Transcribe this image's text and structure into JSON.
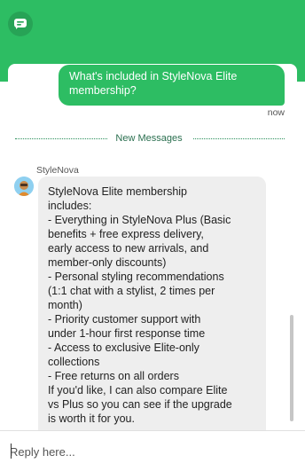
{
  "header": {
    "logo_icon": "chat-bubble-icon",
    "brand_color": "#2dbd63"
  },
  "conversation": {
    "user_message": {
      "lines": [
        "What's included in StyleNova Elite",
        "membership?"
      ],
      "timestamp": "now"
    },
    "divider_label": "New Messages",
    "bot_message": {
      "sender": "StyleNova",
      "avatar_icon": "bot-avatar-icon",
      "lines": [
        "StyleNova Elite membership",
        "includes:",
        "- Everything in StyleNova Plus (Basic",
        "benefits + free express delivery,",
        "early access to new arrivals, and",
        "member-only discounts)",
        "- Personal styling recommendations",
        "(1:1 chat with a stylist, 2 times per",
        "month)",
        "- Priority customer support with",
        "under 1-hour first response time",
        "- Access to exclusive Elite-only",
        "collections",
        "- Free returns on all orders",
        "If you'd like, I can also compare Elite",
        "vs Plus so you can see if the upgrade",
        "is worth it for you."
      ]
    }
  },
  "composer": {
    "placeholder": "Reply here..."
  }
}
